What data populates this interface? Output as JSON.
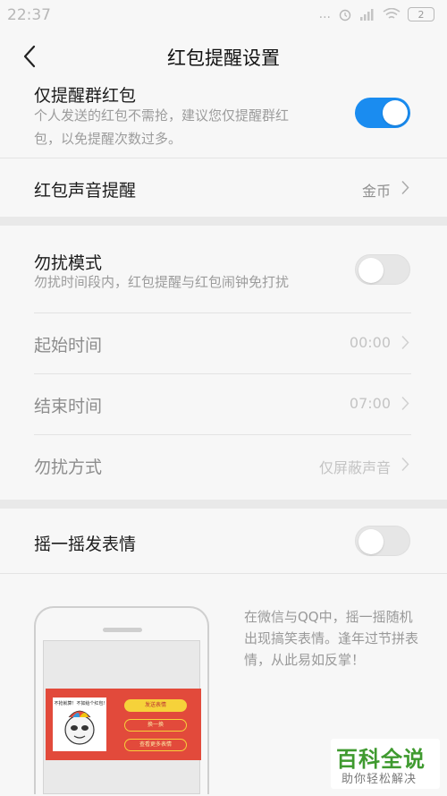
{
  "status_bar": {
    "time": "22:37",
    "signal": "...",
    "battery": "2"
  },
  "nav": {
    "title": "红包提醒设置"
  },
  "settings": {
    "group_only": {
      "title": "仅提醒群红包",
      "desc_line1": "个人发送的红包不需抢，建议您仅提醒群红",
      "desc_line2": "包，以免提醒次数过多。",
      "enabled": true
    },
    "sound": {
      "title": "红包声音提醒",
      "value": "金币"
    },
    "dnd": {
      "title": "勿扰模式",
      "desc": "勿扰时间段内，红包提醒与红包闹钟免打扰",
      "enabled": false
    },
    "start_time": {
      "title": "起始时间",
      "value": "00:00"
    },
    "end_time": {
      "title": "结束时间",
      "value": "07:00"
    },
    "dnd_method": {
      "title": "勿扰方式",
      "value": "仅屏蔽声音"
    },
    "shake": {
      "title": "摇一摇发表情",
      "enabled": false
    }
  },
  "promo": {
    "text": "在微信与QQ中，摇一摇随机出现搞笑表情。逢年过节拼表情，从此易如反掌！",
    "meme_caption": "不抢就算！不如给个红包!",
    "button1": "发送表情",
    "button2": "换一换",
    "button3": "查看更多表情"
  },
  "watermark": {
    "title": "百科全说",
    "subtitle": "助你轻松解决"
  },
  "colors": {
    "accent": "#1a8cf0",
    "background": "#f7f7f7"
  }
}
